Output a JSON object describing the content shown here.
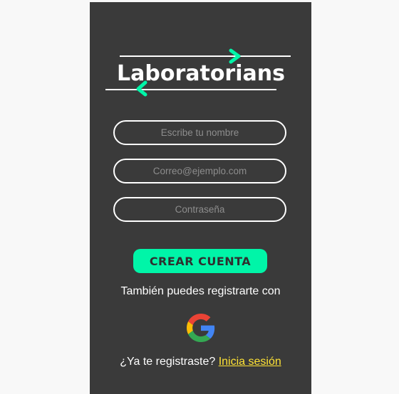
{
  "brand": {
    "name": "Laboratorians",
    "accent_color": "#00f5a8"
  },
  "form": {
    "name_placeholder": "Escribe tu nombre",
    "email_placeholder": "Correo@ejemplo.com",
    "password_placeholder": "Contraseña",
    "name_value": "",
    "email_value": "",
    "password_value": ""
  },
  "actions": {
    "create_account_label": "CREAR CUENTA",
    "alt_signup_text": "También puedes registrarte con",
    "google_icon": "google-icon",
    "already_registered_text": "¿Ya te registraste?",
    "login_link_label": "Inicia sesión",
    "link_color": "#ffe335"
  }
}
